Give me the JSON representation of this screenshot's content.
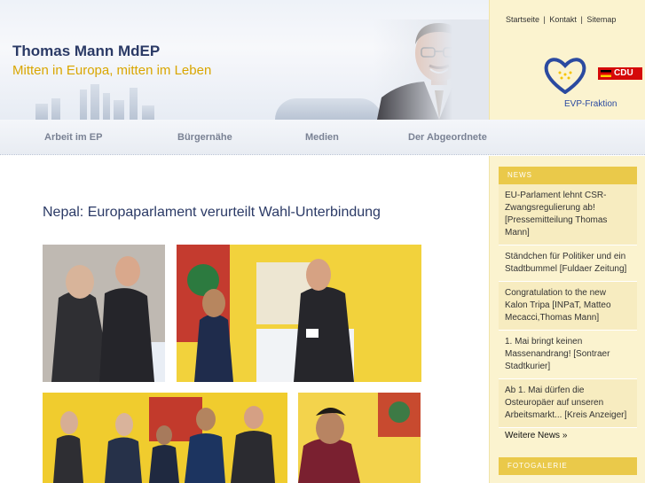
{
  "header": {
    "title": "Thomas Mann MdEP",
    "slogan": "Mitten in Europa, mitten im Leben",
    "topnav": [
      "Startseite",
      "Kontakt",
      "Sitemap"
    ],
    "topnav_separator": "|",
    "evp_label": "EVP-Fraktion",
    "cdu_label": "CDU"
  },
  "mainnav": {
    "items": [
      "Arbeit im EP",
      "Bürgernähe",
      "Medien",
      "Der Abgeordnete"
    ]
  },
  "article": {
    "title": "Nepal: Europaparlament verurteilt Wahl-Unterbindung"
  },
  "sidebar": {
    "news_header": "NEWS",
    "news": [
      "EU-Parlament lehnt CSR-Zwangsregulierung ab! [Pressemitteilung Thomas Mann]",
      "Ständchen für Politiker und ein Stadtbummel [Fuldaer Zeitung]",
      "Congratulation to the new Kalon Tripa [INPaT, Matteo Mecacci,Thomas Mann]",
      "1. Mai bringt keinen Massenandrang! [Sontraer Stadtkurier]",
      "Ab 1. Mai dürfen die Osteuropäer auf unseren Arbeitsmarkt... [Kreis Anzeiger]"
    ],
    "more_news": "Weitere News »",
    "gallery_header": "FOTOGALERIE"
  },
  "colors": {
    "title_blue": "#2b3a66",
    "slogan_yellow": "#d9a600",
    "sidebar_bg": "#fbf3cf",
    "box_header": "#eac94a",
    "cdu_red": "#d50a0a"
  }
}
